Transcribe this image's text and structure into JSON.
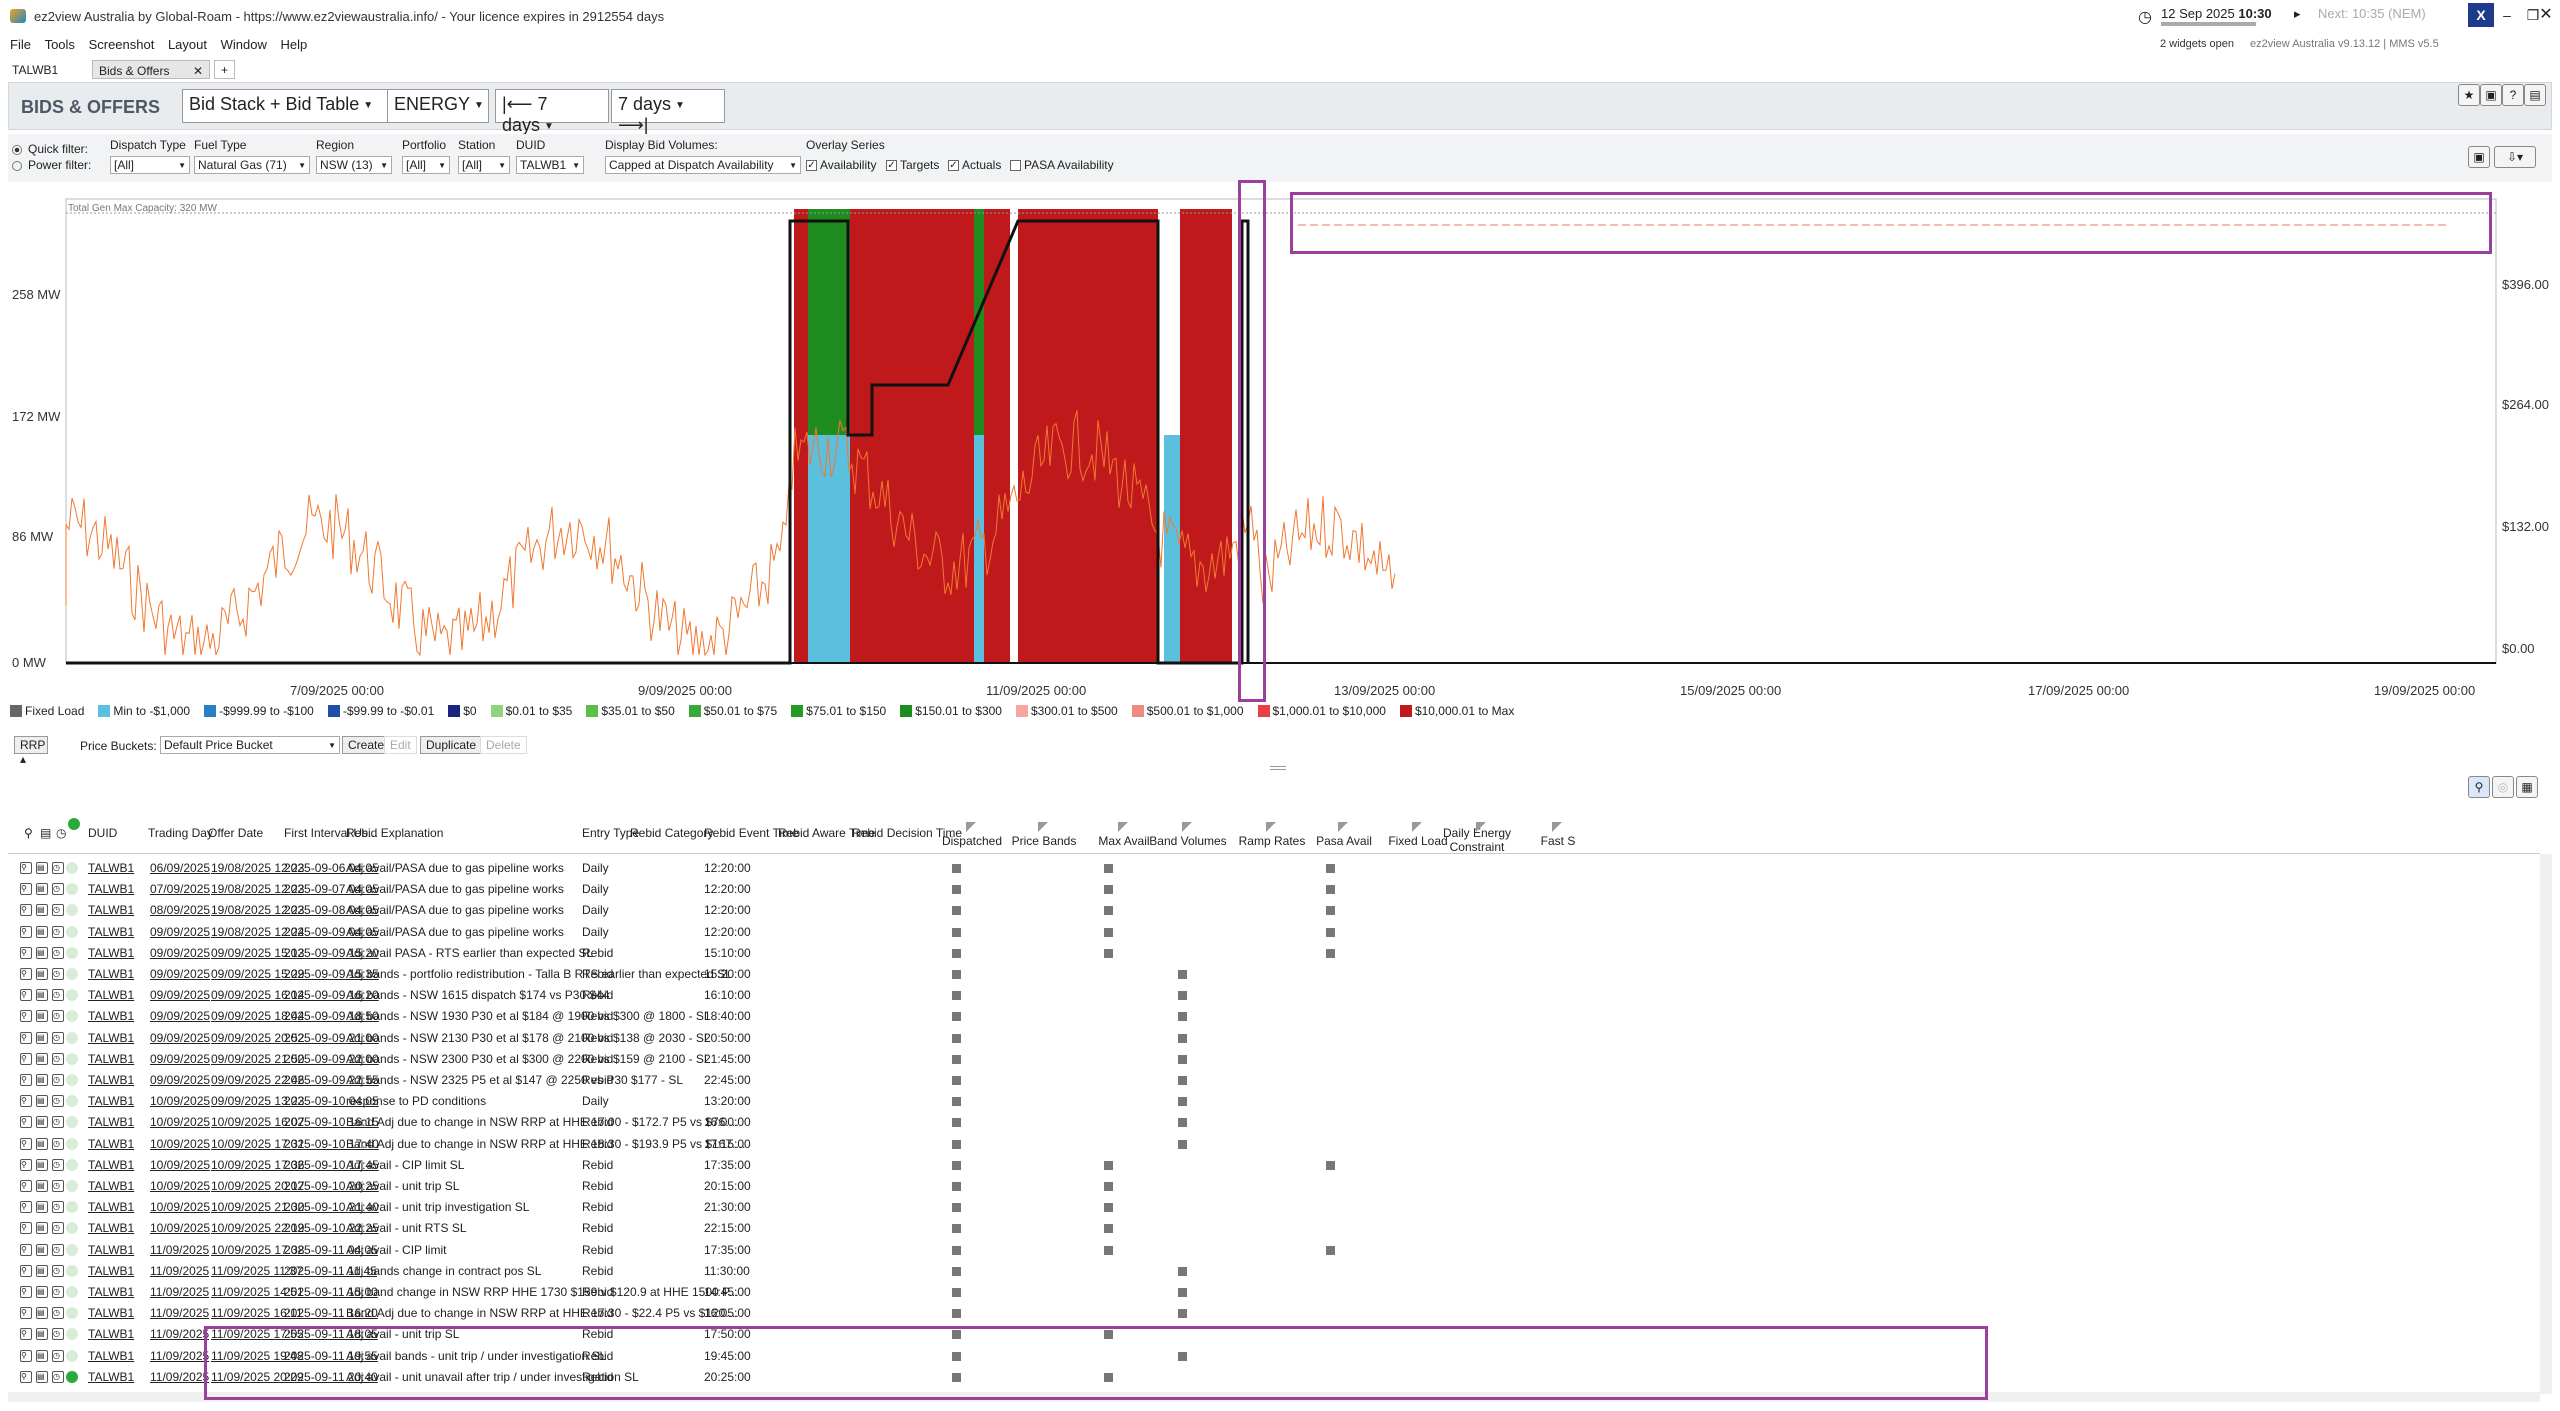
{
  "window": {
    "title": "ez2view Australia by Global-Roam - https://www.ez2viewaustralia.info/ - Your licence expires in 2912554 days",
    "date": "12 Sep 2025",
    "time": "10:30",
    "next": "Next: 10:35 (NEM)",
    "widgets": "2 widgets open",
    "version": "ez2view Australia v9.13.12 | MMS v5.5"
  },
  "menu": [
    "File",
    "Tools",
    "Screenshot",
    "Layout",
    "Window",
    "Help"
  ],
  "tabs": {
    "station": "TALWB1",
    "active": "Bids & Offers",
    "close": "✕",
    "add": "+"
  },
  "header": {
    "title": "BIDS & OFFERS",
    "view": "Bid Stack + Bid Table",
    "market": "ENERGY",
    "back_range": "7 days",
    "fwd_range": "7 days"
  },
  "filters": {
    "quick": "Quick filter:",
    "power": "Power filter:",
    "dispatch_type": {
      "label": "Dispatch Type",
      "value": "[All]"
    },
    "fuel_type": {
      "label": "Fuel Type",
      "value": "Natural Gas (71)"
    },
    "region": {
      "label": "Region",
      "value": "NSW (13)"
    },
    "portfolio": {
      "label": "Portfolio",
      "value": "[All]"
    },
    "station": {
      "label": "Station",
      "value": "[All]"
    },
    "duid": {
      "label": "DUID",
      "value": "TALWB1"
    },
    "display": {
      "label": "Display Bid Volumes:",
      "value": "Capped at Dispatch Availability"
    },
    "overlay": {
      "label": "Overlay Series",
      "availability": "Availability",
      "targets": "Targets",
      "actuals": "Actuals",
      "pasa": "PASA Availability"
    }
  },
  "chart_data": {
    "type": "area",
    "capacity_label": "Total Gen Max Capacity: 320 MW",
    "y_left_ticks": [
      "258 MW",
      "172 MW",
      "86 MW",
      "0 MW"
    ],
    "y_right_ticks": [
      "$396.00",
      "$264.00",
      "$132.00",
      "$0.00"
    ],
    "x_ticks": [
      "7/09/2025 00:00",
      "9/09/2025 00:00",
      "11/09/2025 00:00",
      "13/09/2025 00:00",
      "15/09/2025 00:00",
      "17/09/2025 00:00",
      "19/09/2025 00:00"
    ],
    "ylim": [
      0,
      320
    ],
    "series": [
      {
        "name": "Min to -$1,000",
        "color": "#5bc0de"
      },
      {
        "name": "$150.01 to $300",
        "color": "#1e8c1e"
      },
      {
        "name": "$10,000.01 to Max",
        "color": "#c0191c"
      }
    ]
  },
  "legend": [
    {
      "label": "Fixed Load",
      "color": "#666666"
    },
    {
      "label": "Min to -$1,000",
      "color": "#5bc0de"
    },
    {
      "label": "-$999.99 to -$100",
      "color": "#2a7fc4"
    },
    {
      "label": "-$99.99 to -$0.01",
      "color": "#1f4fa8"
    },
    {
      "label": "$0",
      "color": "#1a237e"
    },
    {
      "label": "$0.01 to $35",
      "color": "#8fd47c"
    },
    {
      "label": "$35.01 to $50",
      "color": "#5cbf4a"
    },
    {
      "label": "$50.01 to $75",
      "color": "#3aa83a"
    },
    {
      "label": "$75.01 to $150",
      "color": "#259a25"
    },
    {
      "label": "$150.01 to $300",
      "color": "#1e8c1e"
    },
    {
      "label": "$300.01 to $500",
      "color": "#f4a8a0"
    },
    {
      "label": "$500.01 to $1,000",
      "color": "#f08a80"
    },
    {
      "label": "$1,000.01 to $10,000",
      "color": "#e84040"
    },
    {
      "label": "$10,000.01 to Max",
      "color": "#c0191c"
    }
  ],
  "price_bar": {
    "rrp": "RRP",
    "label": "Price Buckets:",
    "bucket": "Default Price Bucket",
    "create": "Create",
    "edit": "Edit",
    "duplicate": "Duplicate",
    "delete": "Delete"
  },
  "table": {
    "columns": [
      "DUID",
      "Trading Day",
      "Offer Date",
      "First Interval Us...",
      "Rebid Explanation",
      "Entry Type",
      "Rebid Category",
      "Rebid Event Time",
      "Rebid Aware Time",
      "Rebid Decision Time",
      "Dispatched",
      "Price Bands",
      "Max Avail",
      "Band Volumes",
      "Ramp Rates",
      "Pasa Avail",
      "Fixed Load",
      "Daily Energy Constraint",
      "Fast S"
    ],
    "rows": [
      {
        "d": "TALWB1",
        "td": "06/09/2025",
        "od": "19/08/2025 12:23",
        "fi": "2025-09-06 04:05",
        "ex": "Adj avail/PASA due to gas pipeline works",
        "et": "Daily",
        "rt": "12:20:00",
        "ma": 1,
        "bv": 0,
        "pa": 1
      },
      {
        "d": "TALWB1",
        "td": "07/09/2025",
        "od": "19/08/2025 12:23",
        "fi": "2025-09-07 04:05",
        "ex": "Adj avail/PASA due to gas pipeline works",
        "et": "Daily",
        "rt": "12:20:00",
        "ma": 1,
        "bv": 0,
        "pa": 1
      },
      {
        "d": "TALWB1",
        "td": "08/09/2025",
        "od": "19/08/2025 12:23",
        "fi": "2025-09-08 04:05",
        "ex": "Adj avail/PASA due to gas pipeline works",
        "et": "Daily",
        "rt": "12:20:00",
        "ma": 1,
        "bv": 0,
        "pa": 1
      },
      {
        "d": "TALWB1",
        "td": "09/09/2025",
        "od": "19/08/2025 12:24",
        "fi": "2025-09-09 04:05",
        "ex": "Adj avail/PASA due to gas pipeline works",
        "et": "Daily",
        "rt": "12:20:00",
        "ma": 1,
        "bv": 0,
        "pa": 1
      },
      {
        "d": "TALWB1",
        "td": "09/09/2025",
        "od": "09/09/2025 15:13",
        "fi": "2025-09-09 15:20",
        "ex": "Adj avail PASA - RTS earlier than expected SL",
        "et": "Rebid",
        "rt": "15:10:00",
        "ma": 1,
        "bv": 0,
        "pa": 1
      },
      {
        "d": "TALWB1",
        "td": "09/09/2025",
        "od": "09/09/2025 15:29",
        "fi": "2025-09-09 15:35",
        "ex": "Adj bands - portfolio redistribution - Talla B RTS earlier than expected SL",
        "et": "Rebid",
        "rt": "15:20:00",
        "ma": 0,
        "bv": 1,
        "pa": 0
      },
      {
        "d": "TALWB1",
        "td": "09/09/2025",
        "od": "09/09/2025 16:14",
        "fi": "2025-09-09 16:20",
        "ex": "Adj bands - NSW 1615 dispatch $174 vs P30 $44",
        "et": "Rebid",
        "rt": "16:10:00",
        "ma": 0,
        "bv": 1,
        "pa": 0
      },
      {
        "d": "TALWB1",
        "td": "09/09/2025",
        "od": "09/09/2025 18:44",
        "fi": "2025-09-09 18:50",
        "ex": "Adj bands - NSW 1930 P30 et al $184 @ 1900 vs $300 @ 1800 - SL",
        "et": "Rebid",
        "rt": "18:40:00",
        "ma": 0,
        "bv": 1,
        "pa": 0
      },
      {
        "d": "TALWB1",
        "td": "09/09/2025",
        "od": "09/09/2025 20:52",
        "fi": "2025-09-09 21:00",
        "ex": "Adj bands - NSW 2130 P30 et al $178 @ 2100 vs $138 @ 2030 - SL",
        "et": "Rebid",
        "rt": "20:50:00",
        "ma": 0,
        "bv": 1,
        "pa": 0
      },
      {
        "d": "TALWB1",
        "td": "09/09/2025",
        "od": "09/09/2025 21:50",
        "fi": "2025-09-09 22:00",
        "ex": "Adj bands - NSW 2300 P30 et al $300 @ 2200 vs $159 @ 2100 - SL",
        "et": "Rebid",
        "rt": "21:45:00",
        "ma": 0,
        "bv": 1,
        "pa": 0
      },
      {
        "d": "TALWB1",
        "td": "09/09/2025",
        "od": "09/09/2025 22:46",
        "fi": "2025-09-09 22:55",
        "ex": "Adj bands - NSW 2325 P5 et al $147 @ 2250 vs P30 $177 - SL",
        "et": "Rebid",
        "rt": "22:45:00",
        "ma": 0,
        "bv": 1,
        "pa": 0
      },
      {
        "d": "TALWB1",
        "td": "10/09/2025",
        "od": "09/09/2025 13:23",
        "fi": "2025-09-10 04:05",
        "ex": "response to PD conditions",
        "et": "Daily",
        "rt": "13:20:00",
        "ma": 0,
        "bv": 1,
        "pa": 0
      },
      {
        "d": "TALWB1",
        "td": "10/09/2025",
        "od": "10/09/2025 16:07",
        "fi": "2025-09-10 16:15",
        "ex": "Band Adj due to change in NSW RRP at HHE 17:00 - $172.7 P5 vs $76....",
        "et": "Rebid",
        "rt": "16:00:00",
        "ma": 0,
        "bv": 1,
        "pa": 0
      },
      {
        "d": "TALWB1",
        "td": "10/09/2025",
        "od": "10/09/2025 17:31",
        "fi": "2025-09-10 17:40",
        "ex": "Band Adj due to change in NSW RRP at HHE 18:30 - $193.9 P5 vs $167....",
        "et": "Rebid",
        "rt": "17:15:00",
        "ma": 0,
        "bv": 1,
        "pa": 0
      },
      {
        "d": "TALWB1",
        "td": "10/09/2025",
        "od": "10/09/2025 17:36",
        "fi": "2025-09-10 17:45",
        "ex": "Adj avail - CIP limit SL",
        "et": "Rebid",
        "rt": "17:35:00",
        "ma": 1,
        "bv": 0,
        "pa": 1
      },
      {
        "d": "TALWB1",
        "td": "10/09/2025",
        "od": "10/09/2025 20:17",
        "fi": "2025-09-10 20:25",
        "ex": "Adj avail - unit trip SL",
        "et": "Rebid",
        "rt": "20:15:00",
        "ma": 1,
        "bv": 0,
        "pa": 0
      },
      {
        "d": "TALWB1",
        "td": "10/09/2025",
        "od": "10/09/2025 21:30",
        "fi": "2025-09-10 21:40",
        "ex": "Adj avail - unit trip investigation SL",
        "et": "Rebid",
        "rt": "21:30:00",
        "ma": 1,
        "bv": 0,
        "pa": 0
      },
      {
        "d": "TALWB1",
        "td": "10/09/2025",
        "od": "10/09/2025 22:19",
        "fi": "2025-09-10 22:25",
        "ex": "Adj avail - unit RTS SL",
        "et": "Rebid",
        "rt": "22:15:00",
        "ma": 1,
        "bv": 0,
        "pa": 0
      },
      {
        "d": "TALWB1",
        "td": "11/09/2025",
        "od": "10/09/2025 17:38",
        "fi": "2025-09-11 04:05",
        "ex": "Adj avail - CIP limit",
        "et": "Rebid",
        "rt": "17:35:00",
        "ma": 1,
        "bv": 0,
        "pa": 1
      },
      {
        "d": "TALWB1",
        "td": "11/09/2025",
        "od": "11/09/2025 11:37",
        "fi": "2025-09-11 11:45",
        "ex": "Adj bands change in contract pos SL",
        "et": "Rebid",
        "rt": "11:30:00",
        "ma": 0,
        "bv": 1,
        "pa": 0
      },
      {
        "d": "TALWB1",
        "td": "11/09/2025",
        "od": "11/09/2025 14:51",
        "fi": "2025-09-11 15:00",
        "ex": "Adj band change in NSW RRP HHE 1730 $159 v $120.9 at HHE 1500 P...",
        "et": "Rebid",
        "rt": "14:45:00",
        "ma": 0,
        "bv": 1,
        "pa": 0
      },
      {
        "d": "TALWB1",
        "td": "11/09/2025",
        "od": "11/09/2025 16:11",
        "fi": "2025-09-11 16:20",
        "ex": "Band Adj due to change in NSW RRP at HHE 17:30 - $22.4 P5 vs $120....",
        "et": "Rebid",
        "rt": "16:05:00",
        "ma": 0,
        "bv": 1,
        "pa": 0
      },
      {
        "d": "TALWB1",
        "td": "11/09/2025",
        "od": "11/09/2025 17:55",
        "fi": "2025-09-11 18:05",
        "ex": "Adj avail - unit trip SL",
        "et": "Rebid",
        "rt": "17:50:00",
        "ma": 1,
        "bv": 0,
        "pa": 0
      },
      {
        "d": "TALWB1",
        "td": "11/09/2025",
        "od": "11/09/2025 19:48",
        "fi": "2025-09-11 19:55",
        "ex": "Adj avail bands - unit trip / under investigation SL",
        "et": "Rebid",
        "rt": "19:45:00",
        "ma": 0,
        "bv": 1,
        "pa": 0
      },
      {
        "d": "TALWB1",
        "td": "11/09/2025",
        "od": "11/09/2025 20:29",
        "fi": "2025-09-11 20:40",
        "ex": "Adj avail - unit unavail after trip / under investigation SL",
        "et": "Rebid",
        "rt": "20:25:00",
        "ma": 1,
        "bv": 0,
        "pa": 0
      }
    ]
  }
}
